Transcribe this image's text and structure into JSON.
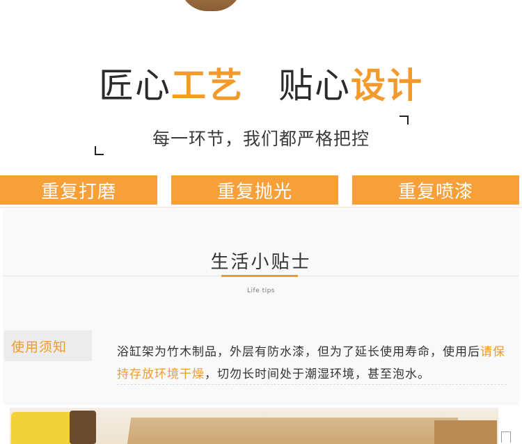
{
  "headline": {
    "part1_black": "匠心",
    "part1_orange": "工艺",
    "part2_black": "贴心",
    "part2_orange": "设计"
  },
  "subline": "每一环节，我们都严格把控",
  "process_bars": [
    "重复打磨",
    "重复抛光",
    "重复喷漆"
  ],
  "tips": {
    "title": "生活小贴士",
    "subtitle": "Life tips",
    "notice_label": "使用须知",
    "notice_text_start": "浴缸架为竹木制品，外层有防水漆，但为了延长使用寿命，使用后",
    "notice_text_highlight": "请保持存放环境干燥",
    "notice_text_end": "，切勿长时间处于潮湿环境，甚至泡水。"
  },
  "colors": {
    "accent": "#f39a2c",
    "bar_orange": "#f7a03a",
    "text_dark": "#333333"
  }
}
